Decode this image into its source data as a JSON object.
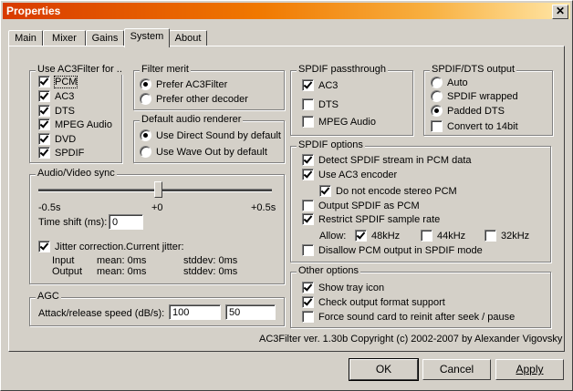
{
  "window": {
    "title": "Properties",
    "close_glyph": "✕"
  },
  "tabs": [
    "Main",
    "Mixer",
    "Gains",
    "System",
    "About"
  ],
  "use_ac3filter": {
    "legend": "Use AC3Filter for ..",
    "items": [
      {
        "label": "PCM",
        "checked": true
      },
      {
        "label": "AC3",
        "checked": true
      },
      {
        "label": "DTS",
        "checked": true
      },
      {
        "label": "MPEG Audio",
        "checked": true
      },
      {
        "label": "DVD",
        "checked": true
      },
      {
        "label": "SPDIF",
        "checked": true
      }
    ]
  },
  "filter_merit": {
    "legend": "Filter merit",
    "opt1": "Prefer AC3Filter",
    "opt2": "Prefer other decoder"
  },
  "renderer": {
    "legend": "Default audio renderer",
    "opt1": "Use Direct Sound by default",
    "opt2": "Use Wave Out by default"
  },
  "av_sync": {
    "legend": "Audio/Video sync",
    "slider_min": "-0.5s",
    "slider_mid": "+0",
    "slider_max": "+0.5s",
    "slider_value": 0.5,
    "time_shift_label": "Time shift (ms):",
    "time_shift_value": "0",
    "jitter_label": "Jitter correction.",
    "current_jitter_label": "Current jitter:",
    "input_label": "Input",
    "output_label": "Output",
    "input_mean": "mean: 0ms",
    "input_stddev": "stddev: 0ms",
    "output_mean": "mean: 0ms",
    "output_stddev": "stddev: 0ms"
  },
  "agc": {
    "legend": "AGC",
    "label": "Attack/release speed (dB/s):",
    "attack": "100",
    "release": "50"
  },
  "passthrough": {
    "legend": "SPDIF passthrough",
    "ac3": "AC3",
    "dts": "DTS",
    "mpeg": "MPEG Audio"
  },
  "spdif_dts": {
    "legend": "SPDIF/DTS output",
    "auto": "Auto",
    "wrapped": "SPDIF wrapped",
    "padded": "Padded DTS",
    "convert": "Convert to 14bit"
  },
  "spdif_opts": {
    "legend": "SPDIF options",
    "detect": "Detect SPDIF stream in PCM data",
    "use_enc": "Use AC3 encoder",
    "no_stereo": "Do not encode stereo PCM",
    "output_pcm": "Output SPDIF as PCM",
    "restrict": "Restrict SPDIF sample rate",
    "allow": "Allow:",
    "r48": "48kHz",
    "r44": "44kHz",
    "r32": "32kHz",
    "disallow": "Disallow PCM output in SPDIF mode"
  },
  "other": {
    "legend": "Other options",
    "tray": "Show tray icon",
    "check": "Check output format support",
    "force": "Force sound card to reinit after seek / pause"
  },
  "copyright": "AC3Filter ver. 1.30b Copyright (c) 2002-2007 by Alexander Vigovsky",
  "buttons": {
    "ok": "OK",
    "cancel": "Cancel",
    "apply": "Apply"
  }
}
